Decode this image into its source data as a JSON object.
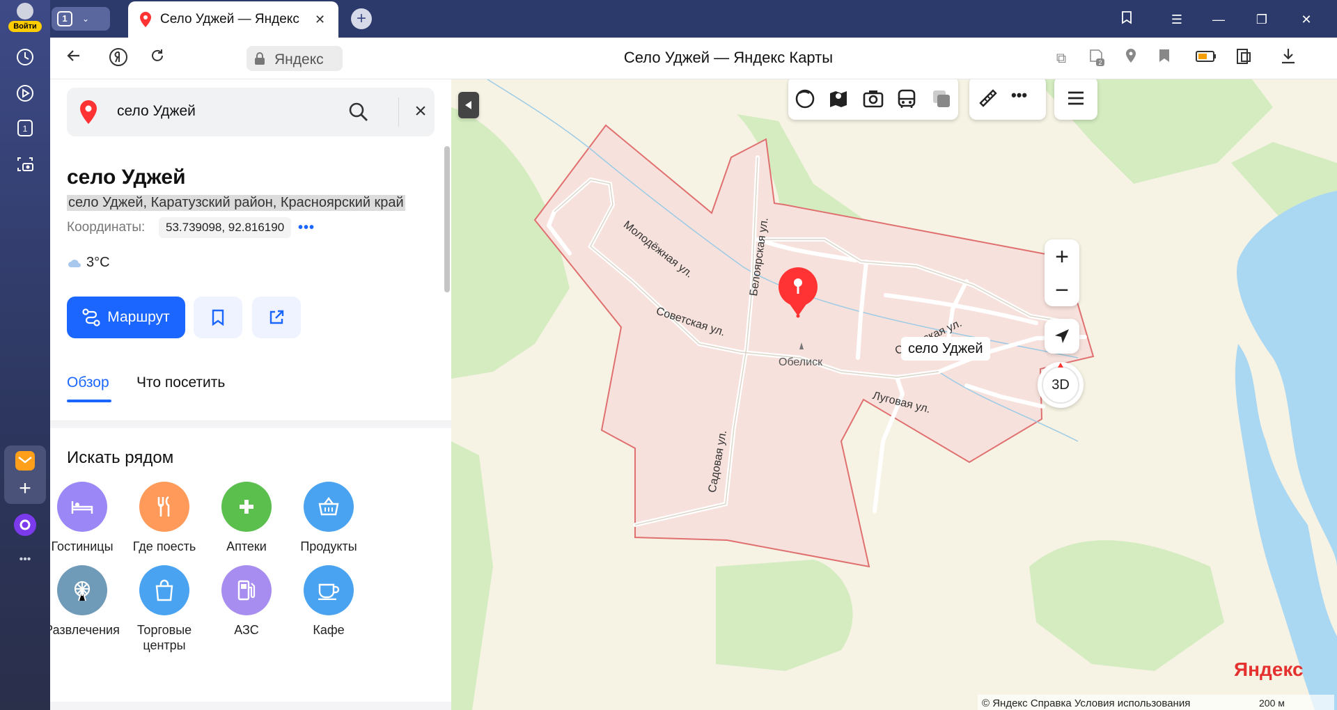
{
  "browser": {
    "login_label": "Войти",
    "tab_count": "1",
    "tab_title": "Село Уджей — Яндекс",
    "address_host": "Яндекс",
    "page_title": "Село Уджей — Яндекс Карты",
    "ext_badge": "2"
  },
  "sidebar": {
    "items": [
      "history-icon",
      "video-icon",
      "tabs-icon",
      "screenshot-icon",
      "mail-icon",
      "add-icon",
      "alice-icon",
      "more-icon"
    ],
    "counter": "1",
    "more": "•••"
  },
  "search": {
    "query": "село Уджей"
  },
  "place": {
    "title": "село Уджей",
    "address": "село Уджей, Каратузский район, Красноярский край",
    "coords_label": "Координаты:",
    "coords_value": "53.739098, 92.816190",
    "coords_more": "•••",
    "weather": "3°C"
  },
  "actions": {
    "route": "Маршрут"
  },
  "tabs": {
    "overview": "Обзор",
    "visit": "Что посетить"
  },
  "nearby": {
    "title": "Искать рядом",
    "categories": [
      {
        "label": "Гостиницы",
        "color": "#9b87f5",
        "icon": "bed-icon"
      },
      {
        "label": "Где поесть",
        "color": "#ff9a5a",
        "icon": "fork-knife-icon"
      },
      {
        "label": "Аптеки",
        "color": "#5bbf4e",
        "icon": "cross-icon"
      },
      {
        "label": "Продукты",
        "color": "#4aa3f0",
        "icon": "basket-icon"
      },
      {
        "label": "Развлечения",
        "color": "#6f9ab8",
        "icon": "ferris-wheel-icon"
      },
      {
        "label": "Торговые\nцентры",
        "color": "#4aa3f0",
        "icon": "shopping-bag-icon"
      },
      {
        "label": "АЗС",
        "color": "#a88df0",
        "icon": "fuel-icon"
      },
      {
        "label": "Кафе",
        "color": "#4aa3f0",
        "icon": "cup-icon"
      }
    ]
  },
  "map": {
    "pin_label": "село Уджей",
    "streets": {
      "molodezhnaya": "Молодёжная ул.",
      "belyarskaya": "Белоярская ул.",
      "sovetskaya1": "Советская ул.",
      "sovetskaya2": "Советская ул.",
      "lugovaya": "Луговая ул.",
      "sadovaya": "Садовая ул."
    },
    "poi": "Обелиск",
    "zoom_in": "+",
    "zoom_out": "−",
    "three_d": "3D",
    "logo": "Яндекс",
    "attribution": "© Яндекс   Справка   Условия использования",
    "scale": "200 м",
    "colors": {
      "boundary": "#e07070",
      "settlement": "#f7e1dc",
      "water": "#aad7f2",
      "forest": "#d4ecc0"
    }
  }
}
